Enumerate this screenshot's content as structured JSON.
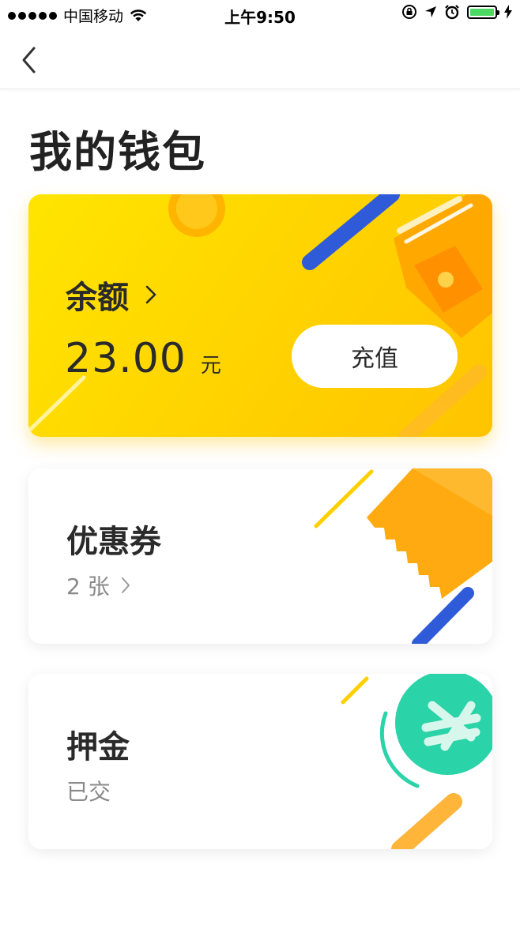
{
  "status_bar": {
    "carrier": "中国移动",
    "time": "上午9:50"
  },
  "nav": {
    "back_icon": "chevron-left-icon"
  },
  "page": {
    "title": "我的钱包"
  },
  "balance_card": {
    "label": "余额",
    "amount": "23.00",
    "unit": "元",
    "recharge_label": "充值",
    "colors": {
      "bg_start": "#ffe500",
      "bg_end": "#ffc400",
      "accent_blue": "#2f5bd8",
      "accent_orange": "#ffa000"
    }
  },
  "coupon_card": {
    "title": "优惠券",
    "count": "2 张"
  },
  "deposit_card": {
    "title": "押金",
    "status": "已交",
    "colors": {
      "teal": "#2ad3a8"
    }
  }
}
